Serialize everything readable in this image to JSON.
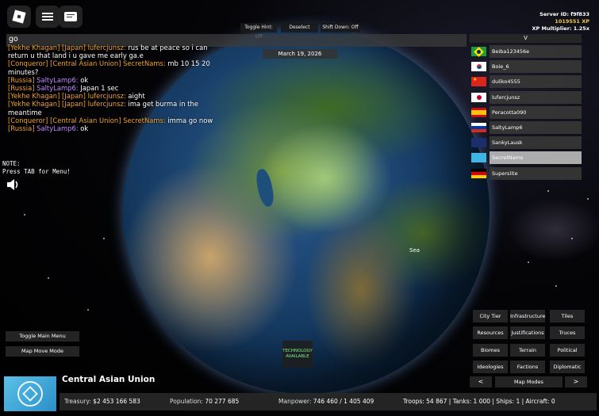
{
  "top_bar": {
    "toggle_hint": "Toggle Hint: Off",
    "deselect": "Deselect",
    "shift_down": "Shift Down: Off"
  },
  "server": {
    "id_line": "Server ID: f9f833",
    "xp_line": "1019551 XP",
    "multiplier_line": "XP Multiplier: 1.25x"
  },
  "chat": {
    "input_text": "go",
    "messages": [
      {
        "tags": "[Yekhe Khagan] [Japan]",
        "name": "lufercjunsz:",
        "name_color": "yellow",
        "text": " rus be at peace so i can return u that land i u gave me early ga.e"
      },
      {
        "tags": "[Conqueror] [Central Asian Union]",
        "name": "SecretNams:",
        "name_color": "yellow",
        "text": " mb 10 15 20 minutes?"
      },
      {
        "tags": "[Russia]",
        "name": "SaltyLamp6:",
        "name_color": "purple",
        "text": " ok"
      },
      {
        "tags": "[Russia]",
        "name": "SaltyLamp6:",
        "name_color": "purple",
        "text": " Japan 1 sec"
      },
      {
        "tags": "[Yekhe Khagan] [Japan]",
        "name": "lufercjunsz:",
        "name_color": "yellow",
        "text": " aight"
      },
      {
        "tags": "[Yekhe Khagan] [Japan]",
        "name": "lufercjunsz:",
        "name_color": "yellow",
        "text": " ima get burma in the meantime"
      },
      {
        "tags": "[Conqueror] [Central Asian Union]",
        "name": "SecretNams:",
        "name_color": "yellow",
        "text": " imma go now"
      },
      {
        "tags": "[Russia]",
        "name": "SaltyLamp6:",
        "name_color": "purple",
        "text": " ok"
      }
    ]
  },
  "date": "March 19, 2026",
  "note": {
    "line1": "NOTE:",
    "line2": "Press TAB for Menu!"
  },
  "map_label_sea": "Sea",
  "player_list": {
    "header": "V",
    "players": [
      {
        "name": "Beiba123456e",
        "flag": "brazil"
      },
      {
        "name": "Boie_6",
        "flag": "south-korea"
      },
      {
        "name": "duliko4555",
        "flag": "china"
      },
      {
        "name": "lufercjunsz",
        "flag": "japan"
      },
      {
        "name": "Peracotta090",
        "flag": "spain"
      },
      {
        "name": "SaltyLamp6",
        "flag": "russia"
      },
      {
        "name": "SankyLausk",
        "flag": "emblem-blue"
      },
      {
        "name": "SecretNams",
        "flag": "central-asian-union"
      },
      {
        "name": "Superslite",
        "flag": "germany"
      }
    ]
  },
  "left_buttons": {
    "toggle_main_menu": "Toggle Main Menu",
    "map_move_mode": "Map Move Mode"
  },
  "tech_notice": "TECHNOLOGY AVAILABLE",
  "map_modes": {
    "grid": [
      "City Tier",
      "Infrastructure",
      "Tiles",
      "Resources",
      "Justifications",
      "Truces",
      "Biomes",
      "Terrain",
      "Political",
      "Ideologies",
      "Factions",
      "Diplomatic"
    ],
    "prev": "<",
    "label": "Map Modes",
    "next": ">"
  },
  "country": {
    "name": "Central Asian Union",
    "treasury_label": "Treasury:",
    "treasury": "$2 453 166 583",
    "population_label": "Population:",
    "population": "70 277 685",
    "manpower_label": "Manpower:",
    "manpower": "746 460  /  1 405 409",
    "military": "Troops: 54 867  |  Tanks: 1 000  |  Ships: 1  |  Aircraft: 0"
  }
}
